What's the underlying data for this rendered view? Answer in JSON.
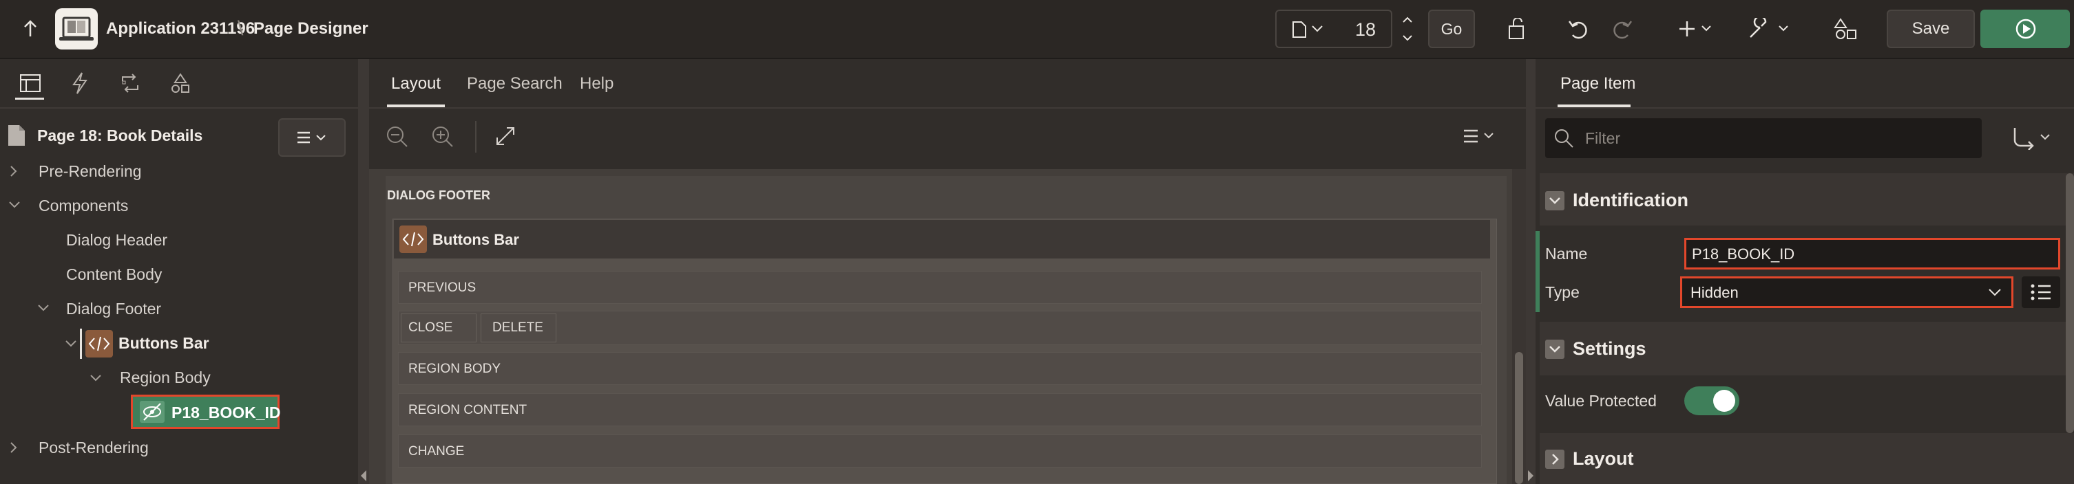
{
  "header": {
    "app_title": "Application 231196",
    "separator": "\\",
    "page_designer": "Page Designer",
    "page_number": "18",
    "go_label": "Go",
    "save_label": "Save"
  },
  "left": {
    "page_title": "Page 18: Book Details",
    "tree": {
      "pre_rendering": "Pre-Rendering",
      "components": "Components",
      "dialog_header": "Dialog Header",
      "content_body": "Content Body",
      "dialog_footer": "Dialog Footer",
      "buttons_bar": "Buttons Bar",
      "region_body": "Region Body",
      "selected_item": "P18_BOOK_ID",
      "post_rendering": "Post-Rendering"
    }
  },
  "center": {
    "tabs": [
      "Layout",
      "Page Search",
      "Help"
    ],
    "section_label": "DIALOG FOOTER",
    "region_title": "Buttons Bar",
    "positions": {
      "previous": "PREVIOUS",
      "close": "CLOSE",
      "delete": "DELETE",
      "region_body": "REGION BODY",
      "region_content": "REGION CONTENT",
      "change": "CHANGE"
    }
  },
  "right": {
    "tab": "Page Item",
    "filter_placeholder": "Filter",
    "identification": {
      "title": "Identification",
      "name_label": "Name",
      "name_value": "P18_BOOK_ID",
      "type_label": "Type",
      "type_value": "Hidden"
    },
    "settings": {
      "title": "Settings",
      "value_protected_label": "Value Protected",
      "value_protected": true
    },
    "layout": {
      "title": "Layout"
    }
  },
  "colors": {
    "accent_green": "#3f7f5a",
    "highlight_red": "#e2472b",
    "component_orange": "#8a5a3c"
  }
}
